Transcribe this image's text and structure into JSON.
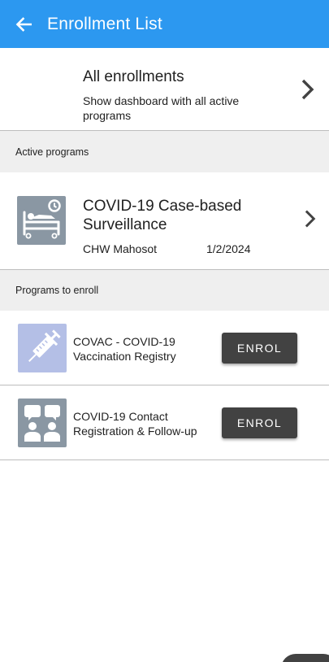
{
  "appbar": {
    "title": "Enrollment List",
    "color": "#2c98f0"
  },
  "all_enrollments": {
    "title": "All enrollments",
    "subtitle": "Show dashboard with all active programs"
  },
  "active_programs": {
    "header": "Active programs",
    "items": [
      {
        "name": "COVID-19 Case-based Surveillance",
        "org_unit": "CHW Mahosot",
        "date": "1/2/2024",
        "icon": "hospital-bed-icon",
        "icon_color": "#8a97a3"
      }
    ]
  },
  "programs_to_enroll": {
    "header": "Programs to enroll",
    "items": [
      {
        "name": "COVAC - COVID-19 Vaccination Registry",
        "button": "ENROL",
        "icon": "syringe-icon",
        "icon_color": "#b4bfe6"
      },
      {
        "name": "COVID-19 Contact Registration & Follow-up",
        "button": "ENROL",
        "icon": "people-talking-icon",
        "icon_color": "#8a97a3"
      }
    ]
  }
}
